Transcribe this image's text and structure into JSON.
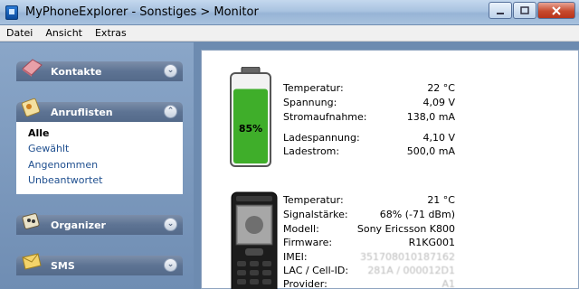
{
  "window": {
    "title": "MyPhoneExplorer - Sonstiges > Monitor",
    "controls": [
      "minimize",
      "maximize",
      "close"
    ]
  },
  "menu": {
    "items": [
      {
        "label": "Datei"
      },
      {
        "label": "Ansicht"
      },
      {
        "label": "Extras"
      }
    ]
  },
  "sidebar": {
    "sections": [
      {
        "label": "Kontakte",
        "icon": "contacts-book-icon",
        "state": "collapsed"
      },
      {
        "label": "Anruflisten",
        "icon": "call-lists-icon",
        "state": "expanded",
        "items": [
          {
            "label": "Alle",
            "active": true
          },
          {
            "label": "Gewählt"
          },
          {
            "label": "Angenommen"
          },
          {
            "label": "Unbeantwortet"
          }
        ]
      },
      {
        "label": "Organizer",
        "icon": "organizer-icon",
        "state": "collapsed"
      },
      {
        "label": "SMS",
        "icon": "sms-envelope-icon",
        "state": "collapsed"
      }
    ]
  },
  "battery": {
    "level_percent": 85,
    "label": "85%",
    "color": "#3fae2a",
    "rows": [
      {
        "label": "Temperatur:",
        "value": "22 °C"
      },
      {
        "label": "Spannung:",
        "value": "4,09 V"
      },
      {
        "label": "Stromaufnahme:",
        "value": "138,0 mA"
      },
      {
        "label": "Ladespannung:",
        "value": "4,10 V"
      },
      {
        "label": "Ladestrom:",
        "value": "500,0 mA"
      }
    ]
  },
  "phone": {
    "rows": [
      {
        "label": "Temperatur:",
        "value": "21 °C"
      },
      {
        "label": "Signalstärke:",
        "value": "68% (-71 dBm)"
      },
      {
        "label": "Modell:",
        "value": "Sony Ericsson K800"
      },
      {
        "label": "Firmware:",
        "value": "R1KG001"
      },
      {
        "label": "IMEI:",
        "value": "351708010187162"
      },
      {
        "label": "LAC / Cell-ID:",
        "value": "281A / 000012D1"
      },
      {
        "label": "Provider:",
        "value": "A1"
      }
    ]
  }
}
